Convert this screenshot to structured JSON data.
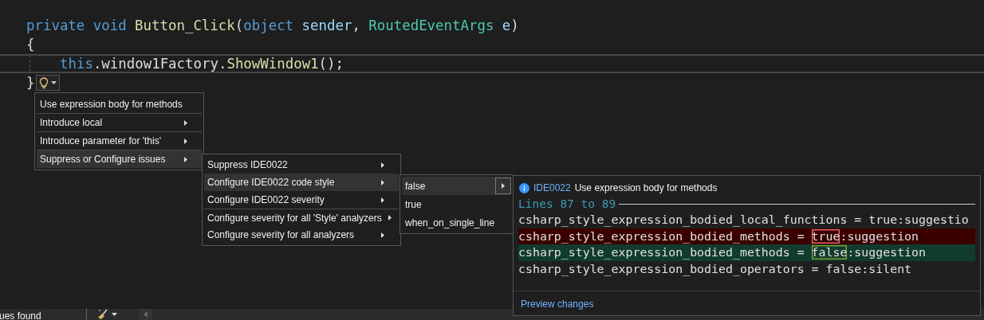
{
  "code_lines": [
    {
      "current": false,
      "indented": false,
      "tokens": [
        {
          "kind": "keyword",
          "text": "private void"
        },
        {
          "kind": "method",
          "text": " Button_Click"
        },
        {
          "kind": "plain",
          "text": "("
        },
        {
          "kind": "keyword",
          "text": "object"
        },
        {
          "kind": "param",
          "text": " sender"
        },
        {
          "kind": "plain",
          "text": ", "
        },
        {
          "kind": "type",
          "text": "RoutedEventArgs"
        },
        {
          "kind": "param",
          "text": " e"
        },
        {
          "kind": "plain",
          "text": ")"
        }
      ]
    },
    {
      "current": false,
      "indented": false,
      "tokens": [
        {
          "kind": "plain",
          "text": "{"
        }
      ]
    },
    {
      "current": true,
      "indented": true,
      "tokens": [
        {
          "kind": "keyword",
          "text": "this"
        },
        {
          "kind": "plain",
          "text": ".window1Factory."
        },
        {
          "kind": "method",
          "text": "ShowWindow1"
        },
        {
          "kind": "plain",
          "text": "();"
        }
      ]
    },
    {
      "current": false,
      "indented": false,
      "tokens": [
        {
          "kind": "plain",
          "text": "}"
        }
      ],
      "lightbulb": true
    }
  ],
  "menus": [
    {
      "items": [
        {
          "label": "Use expression body for methods",
          "submenu": false,
          "selected": false,
          "divider_before": false
        },
        {
          "label": "Introduce local",
          "submenu": true,
          "selected": false,
          "divider_before": true
        },
        {
          "label": "Introduce parameter for 'this'",
          "submenu": true,
          "selected": false,
          "divider_before": true
        },
        {
          "label": "Suppress or Configure issues",
          "submenu": true,
          "selected": true,
          "divider_before": true
        }
      ]
    },
    {
      "items": [
        {
          "label": "Suppress IDE0022",
          "submenu": true,
          "selected": false,
          "divider_before": false
        },
        {
          "label": "Configure IDE0022 code style",
          "submenu": true,
          "selected": true,
          "divider_before": false
        },
        {
          "label": "Configure IDE0022 severity",
          "submenu": true,
          "selected": false,
          "divider_before": false
        },
        {
          "label": "Configure severity for all 'Style' analyzers",
          "submenu": true,
          "selected": false,
          "divider_before": true
        },
        {
          "label": "Configure severity for all analyzers",
          "submenu": true,
          "selected": false,
          "divider_before": false
        }
      ]
    },
    {
      "items": [
        {
          "label": "false",
          "submenu": true,
          "selected": true,
          "divider_before": false
        },
        {
          "label": "true",
          "submenu": false,
          "selected": false,
          "divider_before": false
        },
        {
          "label": "when_on_single_line",
          "submenu": false,
          "selected": false,
          "divider_before": false
        }
      ]
    }
  ],
  "preview": {
    "code": "IDE0022",
    "title": "Use expression body for methods",
    "range": "Lines 87 to 89",
    "lines": [
      {
        "kind": "context",
        "before": "csharp_style_expression_bodied_local_functions = true:suggestio"
      },
      {
        "kind": "removed",
        "before": "csharp_style_expression_bodied_methods = ",
        "changed": "true",
        "after": ":suggestion"
      },
      {
        "kind": "added",
        "before": "csharp_style_expression_bodied_methods = ",
        "changed": "false",
        "after": ":suggestion"
      },
      {
        "kind": "context",
        "before": "csharp_style_expression_bodied_operators = false:silent"
      }
    ],
    "link": "Preview changes"
  },
  "status_bar": {
    "issues": "ues found"
  }
}
